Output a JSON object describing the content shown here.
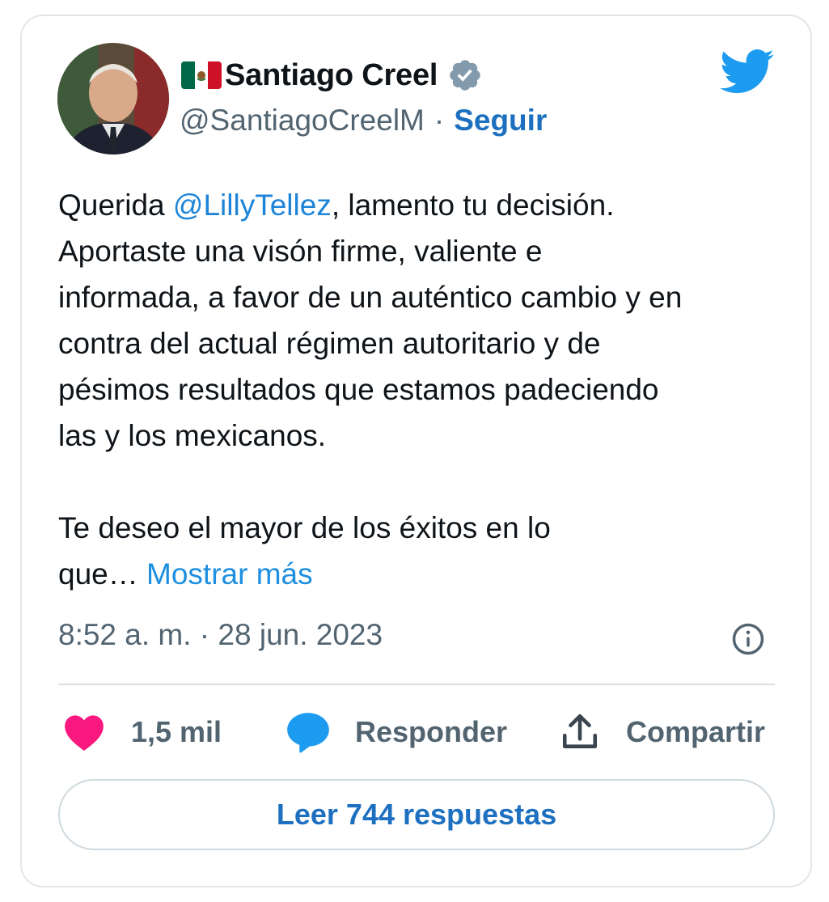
{
  "author": {
    "display_name": "Santiago Creel",
    "handle": "@SantiagoCreelM",
    "separator": "·",
    "follow_label": "Seguir"
  },
  "tweet": {
    "text_prefix": "Querida ",
    "mention": "@LillyTellez",
    "text_body": ", lamento tu decisión.\nAportaste una visón firme, valiente e\ninformada, a favor de un auténtico cambio y en\ncontra del actual régimen autoritario y de\npésimos resultados que estamos padeciendo\nlas y los mexicanos.\n\nTe deseo el mayor de los éxitos en lo\nque… ",
    "show_more_label": "Mostrar más",
    "timestamp": "8:52 a. m. · 28 jun. 2023"
  },
  "actions": {
    "like_count": "1,5 mil",
    "reply_label": "Responder",
    "share_label": "Compartir"
  },
  "read_replies_label": "Leer 744 respuestas",
  "icons": [
    "mexico-flag-icon",
    "verified-badge-icon",
    "twitter-bird-icon",
    "info-icon",
    "heart-icon",
    "reply-bubble-icon",
    "share-icon"
  ],
  "colors": {
    "link": "#1d84d8",
    "follow": "#1d70c0",
    "heart": "#f91880",
    "reply": "#1d9bf0",
    "twitter_blue": "#1d9bf0",
    "muted_text": "#536471"
  }
}
